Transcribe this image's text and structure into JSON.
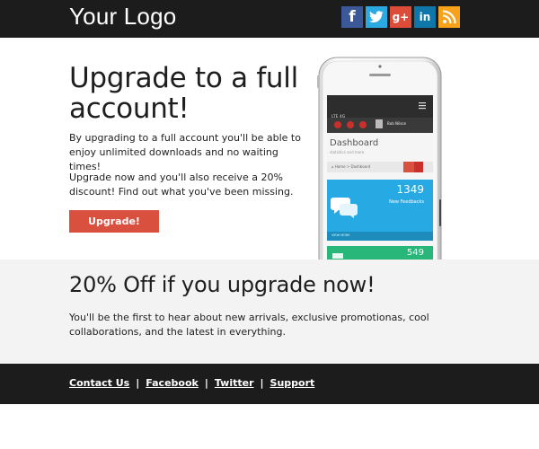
{
  "header": {
    "logo": "Your Logo",
    "social": [
      {
        "name": "facebook",
        "glyph": "f",
        "color": "#3b5998"
      },
      {
        "name": "twitter",
        "glyph": "t",
        "color": "#2ba9e1"
      },
      {
        "name": "google-plus",
        "glyph": "g+",
        "color": "#dd4b39"
      },
      {
        "name": "linkedin",
        "glyph": "in",
        "color": "#0e76a8"
      },
      {
        "name": "rss",
        "glyph": "rss",
        "color": "#f7a21b"
      }
    ]
  },
  "hero": {
    "title": "Upgrade to a full account!",
    "paragraph1": "By upgrading to a full account you'll be able to enjoy unlimited downloads and no waiting times!",
    "paragraph2": "Upgrade now and you'll also receive a 20% discount! Find out what you've been missing.",
    "button": "Upgrade!",
    "button_color": "#d9503f"
  },
  "phone_screen": {
    "carrier": "LTE 4G",
    "user": "Bob Nilson",
    "dashboard_title": "Dashboard",
    "dashboard_subtitle": "statistics and more",
    "breadcrumb_home": "Home",
    "breadcrumb_current": "Dashboard",
    "feedback_count": "1349",
    "feedback_label": "New Feedbacks",
    "view_more": "VIEW MORE",
    "second_count": "549",
    "blue": "#27a9e3",
    "green": "#28b779"
  },
  "promo": {
    "title": "20% Off if you upgrade now!",
    "text": "You'll be the first to hear about new arrivals, exclusive promotionas, cool collaborations, and the latest in everything."
  },
  "footer": {
    "links": [
      "Contact Us",
      "Facebook",
      "Twitter",
      "Support"
    ],
    "separator": "|"
  }
}
